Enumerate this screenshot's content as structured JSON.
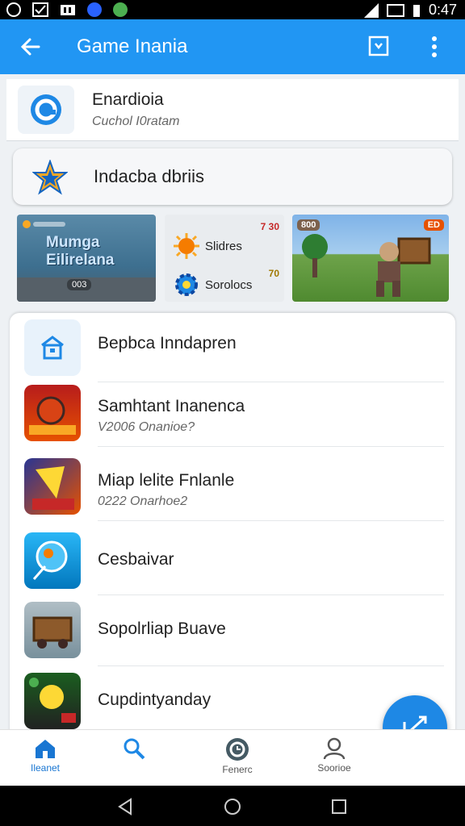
{
  "status_bar": {
    "time": "0:47"
  },
  "app_bar": {
    "title": "Game Inania"
  },
  "account": {
    "name": "Enardioia",
    "subtitle": "Cuchol I0ratam"
  },
  "promo": {
    "label": "Indacba dbriis"
  },
  "tiles": {
    "tile1": {
      "text": "Mumga Eilirelana",
      "stat": "003"
    },
    "tile2": {
      "row1": "Slidres",
      "row2": "Sorolocs",
      "num1": "7 30",
      "num2": "70"
    },
    "tile3": {
      "badge_left": "800",
      "badge_right": "ED"
    }
  },
  "list": {
    "header": {
      "label": "Bepbca Inndapren"
    },
    "items": [
      {
        "title": "Samhtant Inanenca",
        "subtitle": "V2006 Onanioe?"
      },
      {
        "title": "Miap lelite Fnlanle",
        "subtitle": "0222 Onarhoe2"
      },
      {
        "title": "Cesbaivar",
        "subtitle": ""
      },
      {
        "title": "Sopolrliap Buave",
        "subtitle": ""
      },
      {
        "title": "Cupdintyanday",
        "subtitle": ""
      }
    ]
  },
  "bottom_nav": [
    {
      "label": "Ileanet",
      "icon": "home-icon",
      "active": true
    },
    {
      "label": "",
      "icon": "search-icon",
      "active": false
    },
    {
      "label": "Fenerc",
      "icon": "history-icon",
      "active": false
    },
    {
      "label": "Soorioe",
      "icon": "profile-icon",
      "active": false
    }
  ],
  "colors": {
    "primary": "#2196f3",
    "accent": "#1e88e5",
    "background": "#eef1f4"
  }
}
